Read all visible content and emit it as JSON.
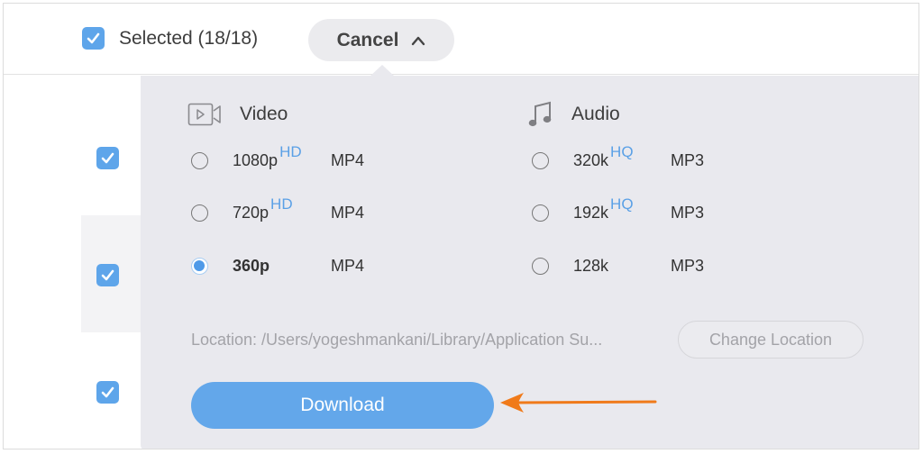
{
  "header": {
    "select_all_checked": true,
    "selected_label": "Selected (18/18)",
    "cancel_label": "Cancel",
    "cancel_icon": "chevron-up-icon"
  },
  "list": {
    "rows": [
      {
        "checked": true
      },
      {
        "checked": true
      },
      {
        "checked": true
      }
    ]
  },
  "panel": {
    "video": {
      "title": "Video",
      "icon": "video-camera-icon",
      "options": [
        {
          "quality": "1080p",
          "badge": "HD",
          "format": "MP4",
          "selected": false
        },
        {
          "quality": "720p",
          "badge": "HD",
          "format": "MP4",
          "selected": false
        },
        {
          "quality": "360p",
          "badge": "",
          "format": "MP4",
          "selected": true
        }
      ]
    },
    "audio": {
      "title": "Audio",
      "icon": "music-note-icon",
      "options": [
        {
          "quality": "320k",
          "badge": "HQ",
          "format": "MP3",
          "selected": false
        },
        {
          "quality": "192k",
          "badge": "HQ",
          "format": "MP3",
          "selected": false
        },
        {
          "quality": "128k",
          "badge": "",
          "format": "MP3",
          "selected": false
        }
      ]
    },
    "location_text": "Location: /Users/yogeshmankani/Library/Application Su...",
    "change_location_label": "Change Location",
    "download_label": "Download"
  },
  "colors": {
    "accent": "#5ea5ea",
    "badge": "#5aa0e6",
    "panel_bg": "#e9e9ee",
    "annotation_arrow": "#f07a1a"
  }
}
